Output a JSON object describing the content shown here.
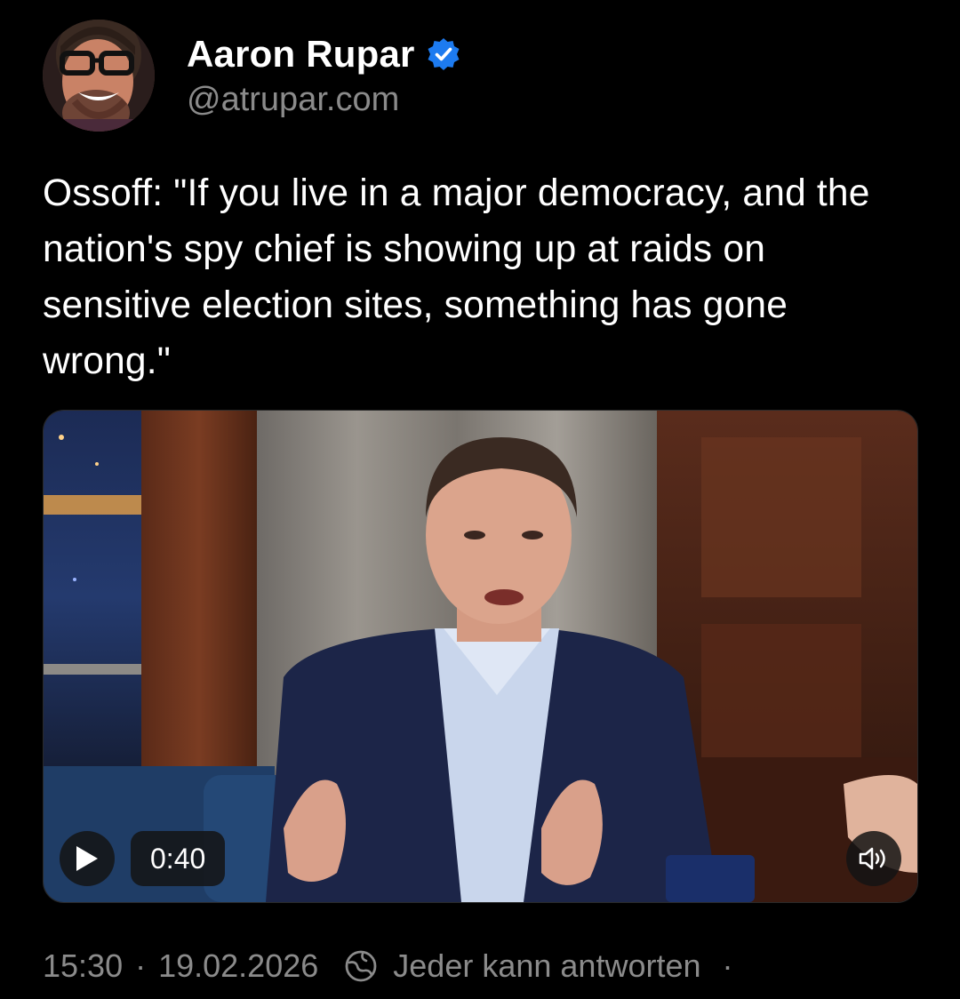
{
  "author": {
    "display_name": "Aaron Rupar",
    "handle": "@atrupar.com",
    "verified_icon": "verified-badge-icon",
    "accent_color": "#1d7bf0"
  },
  "post": {
    "text": "Ossoff: \"If you live in a major democracy, and the nation's spy chief is showing up at raids on sensitive election sites, something has gone wrong.\""
  },
  "media": {
    "type": "video",
    "duration": "0:40",
    "play_icon": "play-icon",
    "sound_icon": "speaker-icon"
  },
  "meta": {
    "time": "15:30",
    "separator": "·",
    "date": "19.02.2026",
    "reply_icon": "reply-permission-icon",
    "reply_setting": "Jeder kann antworten",
    "trailing": "·"
  },
  "colors": {
    "background": "#000000",
    "text": "#ffffff",
    "muted": "#8b8b8b"
  }
}
